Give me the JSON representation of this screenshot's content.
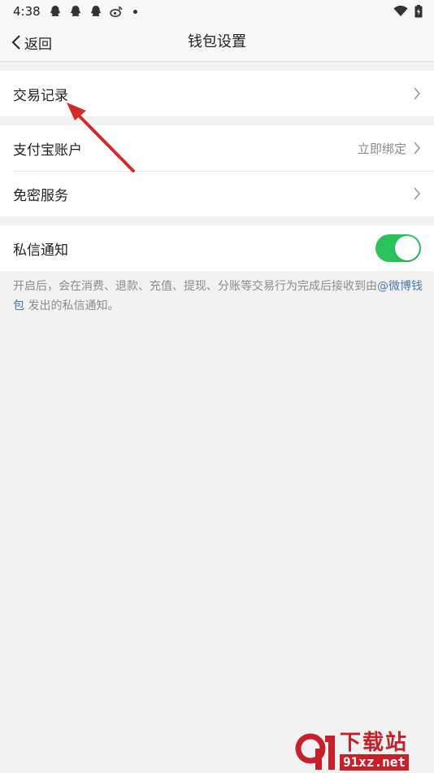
{
  "status_bar": {
    "time": "4:38",
    "icons": [
      "qq-icon",
      "qq-icon",
      "qq-icon",
      "weibo-icon",
      "dot"
    ],
    "right_icons": [
      "wifi-icon",
      "battery-icon"
    ]
  },
  "nav": {
    "back_label": "返回",
    "title": "钱包设置"
  },
  "groups": {
    "records": {
      "label": "交易记录"
    },
    "alipay": {
      "label": "支付宝账户",
      "value": "立即绑定"
    },
    "password_free": {
      "label": "免密服务"
    },
    "notify": {
      "label": "私信通知",
      "enabled": true
    }
  },
  "note": {
    "text_before": "开启后，会在消费、退款、充值、提现、分账等交易行为完成后接收到由",
    "link": "@微博钱包",
    "text_after": " 发出的私信通知。"
  },
  "watermark": {
    "top": "下载站",
    "bottom": "91xz.net"
  },
  "colors": {
    "toggle_on": "#2ac35b",
    "link": "#4a77a8",
    "arrow": "#d42a2a",
    "watermark": "#c8202a"
  }
}
